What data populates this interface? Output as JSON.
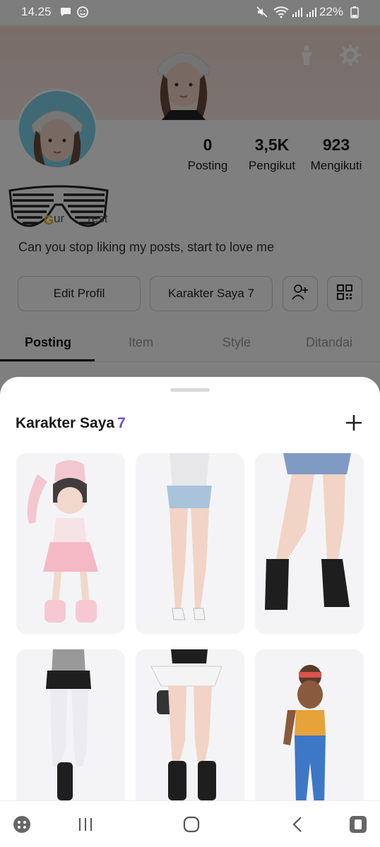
{
  "status_bar": {
    "time": "14.25",
    "battery": "22%",
    "icons": [
      "chat-bubble-icon",
      "smiley-icon",
      "mute-icon",
      "wifi-icon",
      "signal-icon",
      "signal-icon",
      "battery-icon"
    ]
  },
  "profile": {
    "stats": [
      {
        "value": "0",
        "label": "Posting"
      },
      {
        "value": "3,5K",
        "label": "Pengikut"
      },
      {
        "value": "923",
        "label": "Mengikuti"
      }
    ],
    "badge_letter": "G",
    "username_partial": "ur       rest",
    "bio": "Can you stop liking my posts, start to love me",
    "buttons": {
      "edit": "Edit Profil",
      "characters": "Karakter Saya 7"
    },
    "tabs": [
      "Posting",
      "Item",
      "Style",
      "Ditandai"
    ],
    "active_tab": "Posting"
  },
  "sheet": {
    "title": "Karakter Saya",
    "count": "7",
    "add_icon": "plus-icon",
    "cards": [
      {
        "name": "character-1",
        "outfit": "pink-bunny-hood"
      },
      {
        "name": "character-2",
        "outfit": "denim-shorts-heels"
      },
      {
        "name": "character-3",
        "outfit": "denim-skirt-boots"
      },
      {
        "name": "character-4",
        "outfit": "black-skirt-boots"
      },
      {
        "name": "character-5",
        "outfit": "white-skirt-boots"
      },
      {
        "name": "character-6",
        "outfit": "jeans-bandana"
      }
    ]
  },
  "nav_bar": {
    "icons": [
      "game-launcher-icon",
      "recent-apps-icon",
      "home-icon",
      "back-icon",
      "screen-rotate-icon"
    ]
  },
  "colors": {
    "accent": "#6a4ce0",
    "scrim": "rgba(0,0,0,0.5)",
    "card_bg": "#f4f4f7",
    "avatar_bg": "#7fd3e8"
  }
}
